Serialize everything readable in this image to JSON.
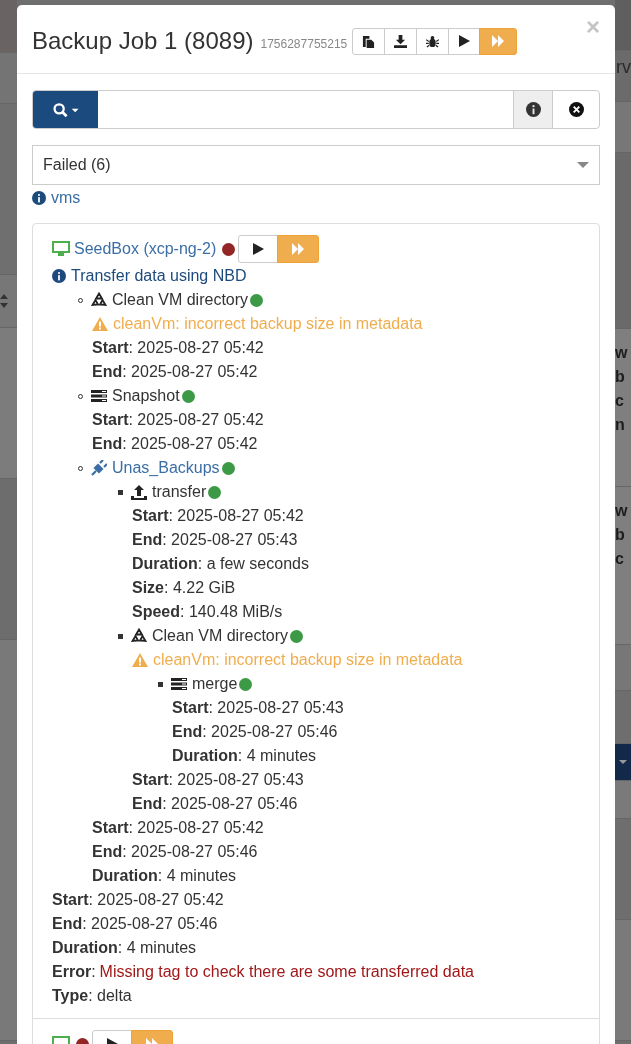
{
  "background": {
    "header_fragment": "rv",
    "row_groups": [
      [
        "w",
        "b",
        "c",
        "n"
      ],
      [
        "w",
        "b",
        "c"
      ]
    ]
  },
  "modal": {
    "title": "Backup Job 1 (8089)",
    "job_id": "1756287755215",
    "close": "×"
  },
  "filter": {
    "value": "Failed (6)"
  },
  "info_link": "vms",
  "vms": [
    {
      "name": "SeedBox (xcp-ng-2)",
      "color": "#922626",
      "info": "Transfer data using NBD",
      "tasks": [
        {
          "kind": "clean",
          "title": "Clean VM directory",
          "color": "#3c9a46",
          "warning": "cleanVm: incorrect backup size in metadata",
          "fields": [
            {
              "line": "**Start**: 2025-08-27 05:42"
            },
            {
              "line": "**End**: 2025-08-27 05:42"
            }
          ]
        },
        {
          "kind": "snapshot",
          "title": "Snapshot",
          "color": "#3c9a46",
          "fields": [
            {
              "line": "**Start**: 2025-08-27 05:42"
            },
            {
              "line": "**End**: 2025-08-27 05:42"
            }
          ]
        },
        {
          "kind": "remote",
          "title": "Unas_Backups",
          "color": "#3c9a46",
          "children": [
            {
              "kind": "transfer",
              "title": "transfer",
              "color": "#3c9a46",
              "fields": [
                {
                  "line": "**Start**: 2025-08-27 05:42"
                },
                {
                  "line": "**End**: 2025-08-27 05:43"
                },
                {
                  "line": "**Duration**: a few seconds"
                },
                {
                  "line": "**Size**: 4.22 GiB"
                },
                {
                  "line": "**Speed**: 140.48 MiB/s"
                }
              ]
            },
            {
              "kind": "clean",
              "title": "Clean VM directory",
              "color": "#3c9a46",
              "warning": "cleanVm: incorrect backup size in metadata",
              "children": [
                {
                  "kind": "merge",
                  "title": "merge",
                  "color": "#3c9a46",
                  "fields": [
                    {
                      "line": "**Start**: 2025-08-27 05:43"
                    },
                    {
                      "line": "**End**: 2025-08-27 05:46"
                    },
                    {
                      "line": "**Duration**: 4 minutes"
                    }
                  ]
                }
              ],
              "fields": [
                {
                  "line": "**Start**: 2025-08-27 05:43"
                },
                {
                  "line": "**End**: 2025-08-27 05:46"
                }
              ]
            }
          ],
          "fields": [
            {
              "line": "**Start**: 2025-08-27 05:42"
            },
            {
              "line": "**End**: 2025-08-27 05:46"
            },
            {
              "line": "**Duration**: 4 minutes"
            }
          ]
        }
      ],
      "fields": [
        {
          "line": "**Start**: 2025-08-27 05:42"
        },
        {
          "line": "**End**: 2025-08-27 05:46"
        },
        {
          "line": "**Duration**: 4 minutes"
        },
        {
          "line": "**Error**:",
          "message": "Missing tag to check there are some transferred data"
        },
        {
          "line": "**Type**: delta"
        }
      ]
    },
    {
      "color": "#922626"
    }
  ]
}
